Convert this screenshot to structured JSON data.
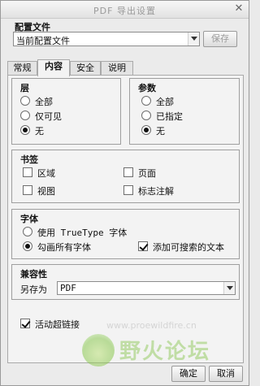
{
  "window": {
    "title": "PDF 导出设置",
    "close_glyph": "✕"
  },
  "profile": {
    "heading": "配置文件",
    "selected": "当前配置文件",
    "save_label": "保存"
  },
  "tabs": [
    {
      "label": "常规",
      "active": false
    },
    {
      "label": "内容",
      "active": true
    },
    {
      "label": "安全",
      "active": false
    },
    {
      "label": "说明",
      "active": false
    }
  ],
  "layers": {
    "title": "层",
    "options": [
      {
        "label": "全部",
        "selected": false
      },
      {
        "label": "仅可见",
        "selected": false
      },
      {
        "label": "无",
        "selected": true
      }
    ]
  },
  "params": {
    "title": "参数",
    "options": [
      {
        "label": "全部",
        "selected": false
      },
      {
        "label": "已指定",
        "selected": false
      },
      {
        "label": "无",
        "selected": true
      }
    ]
  },
  "bookmarks": {
    "title": "书签",
    "items": [
      {
        "label": "区域",
        "checked": false
      },
      {
        "label": "页面",
        "checked": false
      },
      {
        "label": "视图",
        "checked": false
      },
      {
        "label": "标志注解",
        "checked": false
      }
    ]
  },
  "fonts": {
    "title": "字体",
    "use_truetype": {
      "label": "使用 TrueType 字体",
      "selected": false
    },
    "outline_all": {
      "label": "勾画所有字体",
      "selected": true
    },
    "searchable_text": {
      "label": "添加可搜索的文本",
      "checked": true
    }
  },
  "compat": {
    "title": "兼容性",
    "save_as_label": "另存为",
    "save_as_value": "PDF"
  },
  "hyperlinks": {
    "label": "活动超链接",
    "checked": true
  },
  "footer": {
    "ok_label": "确定",
    "cancel_label": "取消"
  },
  "watermark": {
    "text": "野火论坛",
    "url": "www.proewildfire.cn"
  }
}
